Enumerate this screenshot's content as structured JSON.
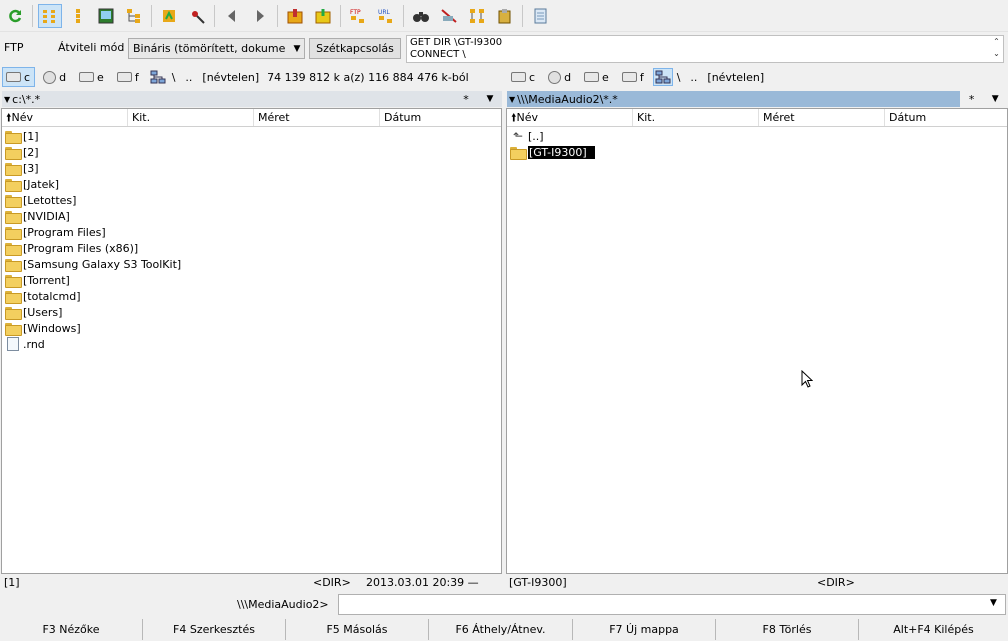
{
  "toolbar": {
    "buttons": [
      {
        "icon": "refresh-icon"
      },
      {
        "icon": "brief-view-icon"
      },
      {
        "icon": "full-view-icon"
      },
      {
        "icon": "thumbnails-icon"
      },
      {
        "icon": "tree-icon"
      },
      {
        "icon": "sort-icon"
      },
      {
        "icon": "invert-selection-icon"
      },
      {
        "icon": "back-icon"
      },
      {
        "icon": "forward-icon"
      },
      {
        "icon": "pack-icon"
      },
      {
        "icon": "unpack-icon"
      },
      {
        "icon": "ftp-connect-icon"
      },
      {
        "icon": "url-connect-icon"
      },
      {
        "icon": "search-icon"
      },
      {
        "icon": "multi-rename-icon"
      },
      {
        "icon": "sync-dirs-icon"
      },
      {
        "icon": "copy-names-icon"
      },
      {
        "icon": "notepad-icon"
      }
    ]
  },
  "ftp": {
    "label": "FTP",
    "mode_label": "Átviteli mód",
    "mode_value": "Bináris (tömörített, dokume",
    "disconnect_label": "Szétkapcsolás",
    "log_lines": [
      "GET DIR \\GT-I9300",
      "CONNECT \\"
    ]
  },
  "left": {
    "drives": [
      "c",
      "d",
      "e",
      "f"
    ],
    "root": "\\",
    "up": "..",
    "volume_label": "[névtelen]",
    "space_info": "74 139 812 k a(z) 116 884 476 k-ból",
    "path": "c:\\*.*",
    "star": "*",
    "columns": [
      "Név",
      "Kit.",
      "Méret",
      "Dátum"
    ],
    "items": [
      {
        "name": "[1]",
        "type": "folder"
      },
      {
        "name": "[2]",
        "type": "folder"
      },
      {
        "name": "[3]",
        "type": "folder"
      },
      {
        "name": "[Jatek]",
        "type": "folder"
      },
      {
        "name": "[Letottes]",
        "type": "folder"
      },
      {
        "name": "[NVIDIA]",
        "type": "folder"
      },
      {
        "name": "[Program Files]",
        "type": "folder"
      },
      {
        "name": "[Program Files (x86)]",
        "type": "folder"
      },
      {
        "name": "[Samsung Galaxy S3 ToolKit]",
        "type": "folder"
      },
      {
        "name": "[Torrent]",
        "type": "folder"
      },
      {
        "name": "[totalcmd]",
        "type": "folder"
      },
      {
        "name": "[Users]",
        "type": "folder"
      },
      {
        "name": "[Windows]",
        "type": "folder"
      },
      {
        "name": ".rnd",
        "type": "file"
      }
    ],
    "status_name": "[1]",
    "status_size": "<DIR>",
    "status_date": "2013.03.01 20:39 —"
  },
  "right": {
    "drives": [
      "c",
      "d",
      "e",
      "f"
    ],
    "root": "\\",
    "up": "..",
    "volume_label": "[névtelen]",
    "path": "\\\\\\MediaAudio2\\*.*",
    "star": "*",
    "columns": [
      "Név",
      "Kit.",
      "Méret",
      "Dátum"
    ],
    "items": [
      {
        "name": "[..]",
        "type": "up"
      },
      {
        "name": "[GT-I9300]",
        "type": "folder",
        "selected": true
      }
    ],
    "status_name": "[GT-I9300]",
    "status_size": "<DIR>"
  },
  "command": {
    "label": "\\\\\\MediaAudio2>",
    "value": ""
  },
  "fkeys": [
    "F3 Nézőke",
    "F4 Szerkesztés",
    "F5 Másolás",
    "F6 Áthely/Átnev.",
    "F7 Új mappa",
    "F8 Törlés",
    "Alt+F4 Kilépés"
  ]
}
